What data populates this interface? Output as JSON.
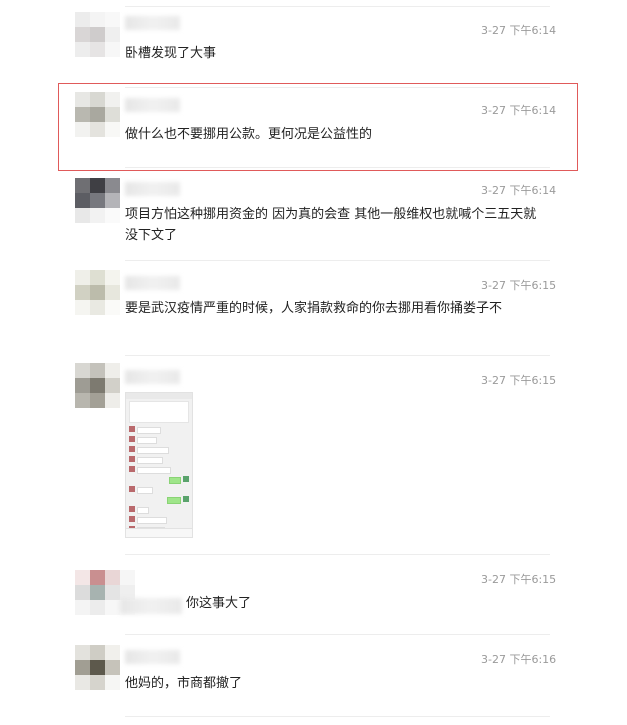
{
  "comments": [
    {
      "time": "3-27 下午6:14",
      "text": "卧槽发现了大事"
    },
    {
      "time": "3-27 下午6:14",
      "text": "做什么也不要挪用公款。更何况是公益性的"
    },
    {
      "time": "3-27 下午6:14",
      "text": "项目方怕这种挪用资金的 因为真的会查 其他一般维权也就喊个三五天就没下文了"
    },
    {
      "time": "3-27 下午6:15",
      "text": "要是武汉疫情严重的时候，人家捐款救命的你去挪用看你捅娄子不"
    },
    {
      "time": "3-27 下午6:15",
      "text": ""
    },
    {
      "time": "3-27 下午6:15",
      "text": "你这事大了"
    },
    {
      "time": "3-27 下午6:16",
      "text": "他妈的，市商都撤了"
    }
  ],
  "colors": {
    "highlight": "#e05a5a",
    "timestamp": "#9a9a9a",
    "divider": "#ededed"
  },
  "icons": {
    "avatar": "blurred-avatar-icon",
    "screenshot": "chat-screenshot-thumbnail"
  }
}
